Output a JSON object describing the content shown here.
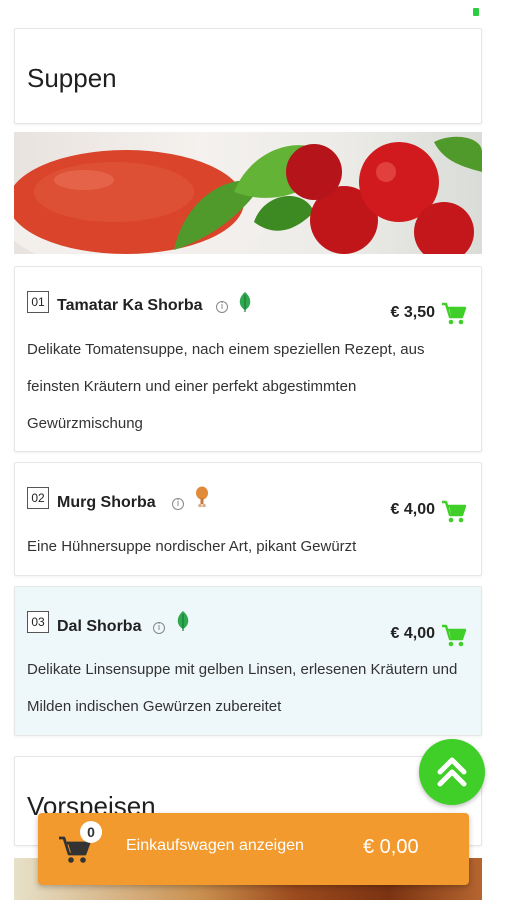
{
  "sections": {
    "soups_title": "Suppen",
    "starters_title": "Vorspeisen"
  },
  "items": [
    {
      "number": "01",
      "name": "Tamatar Ka Shorba",
      "tag": "leaf-icon",
      "price": "€ 3,50",
      "description": "Delikate Tomatensuppe, nach einem speziellen Rezept, aus feinsten Kräutern und einer perfekt abgestimmten Gewürzmischung"
    },
    {
      "number": "02",
      "name": "Murg Shorba",
      "tag": "chicken-leg-icon",
      "price": "€ 4,00",
      "description": "Eine Hühnersuppe nordischer Art, pikant Gewürzt"
    },
    {
      "number": "03",
      "name": "Dal Shorba",
      "tag": "leaf-icon",
      "price": "€ 4,00",
      "description": "Delikate Linsensuppe mit gelben Linsen, erlesenen Kräutern und Milden indischen Gewürzen zubereitet"
    }
  ],
  "cart": {
    "count": "0",
    "label": "Einkaufswagen anzeigen",
    "total": "€ 0,00"
  },
  "colors": {
    "accent_green": "#3fcf28",
    "cart_bar": "#f29a2e",
    "highlight_card": "#eef8fa"
  }
}
